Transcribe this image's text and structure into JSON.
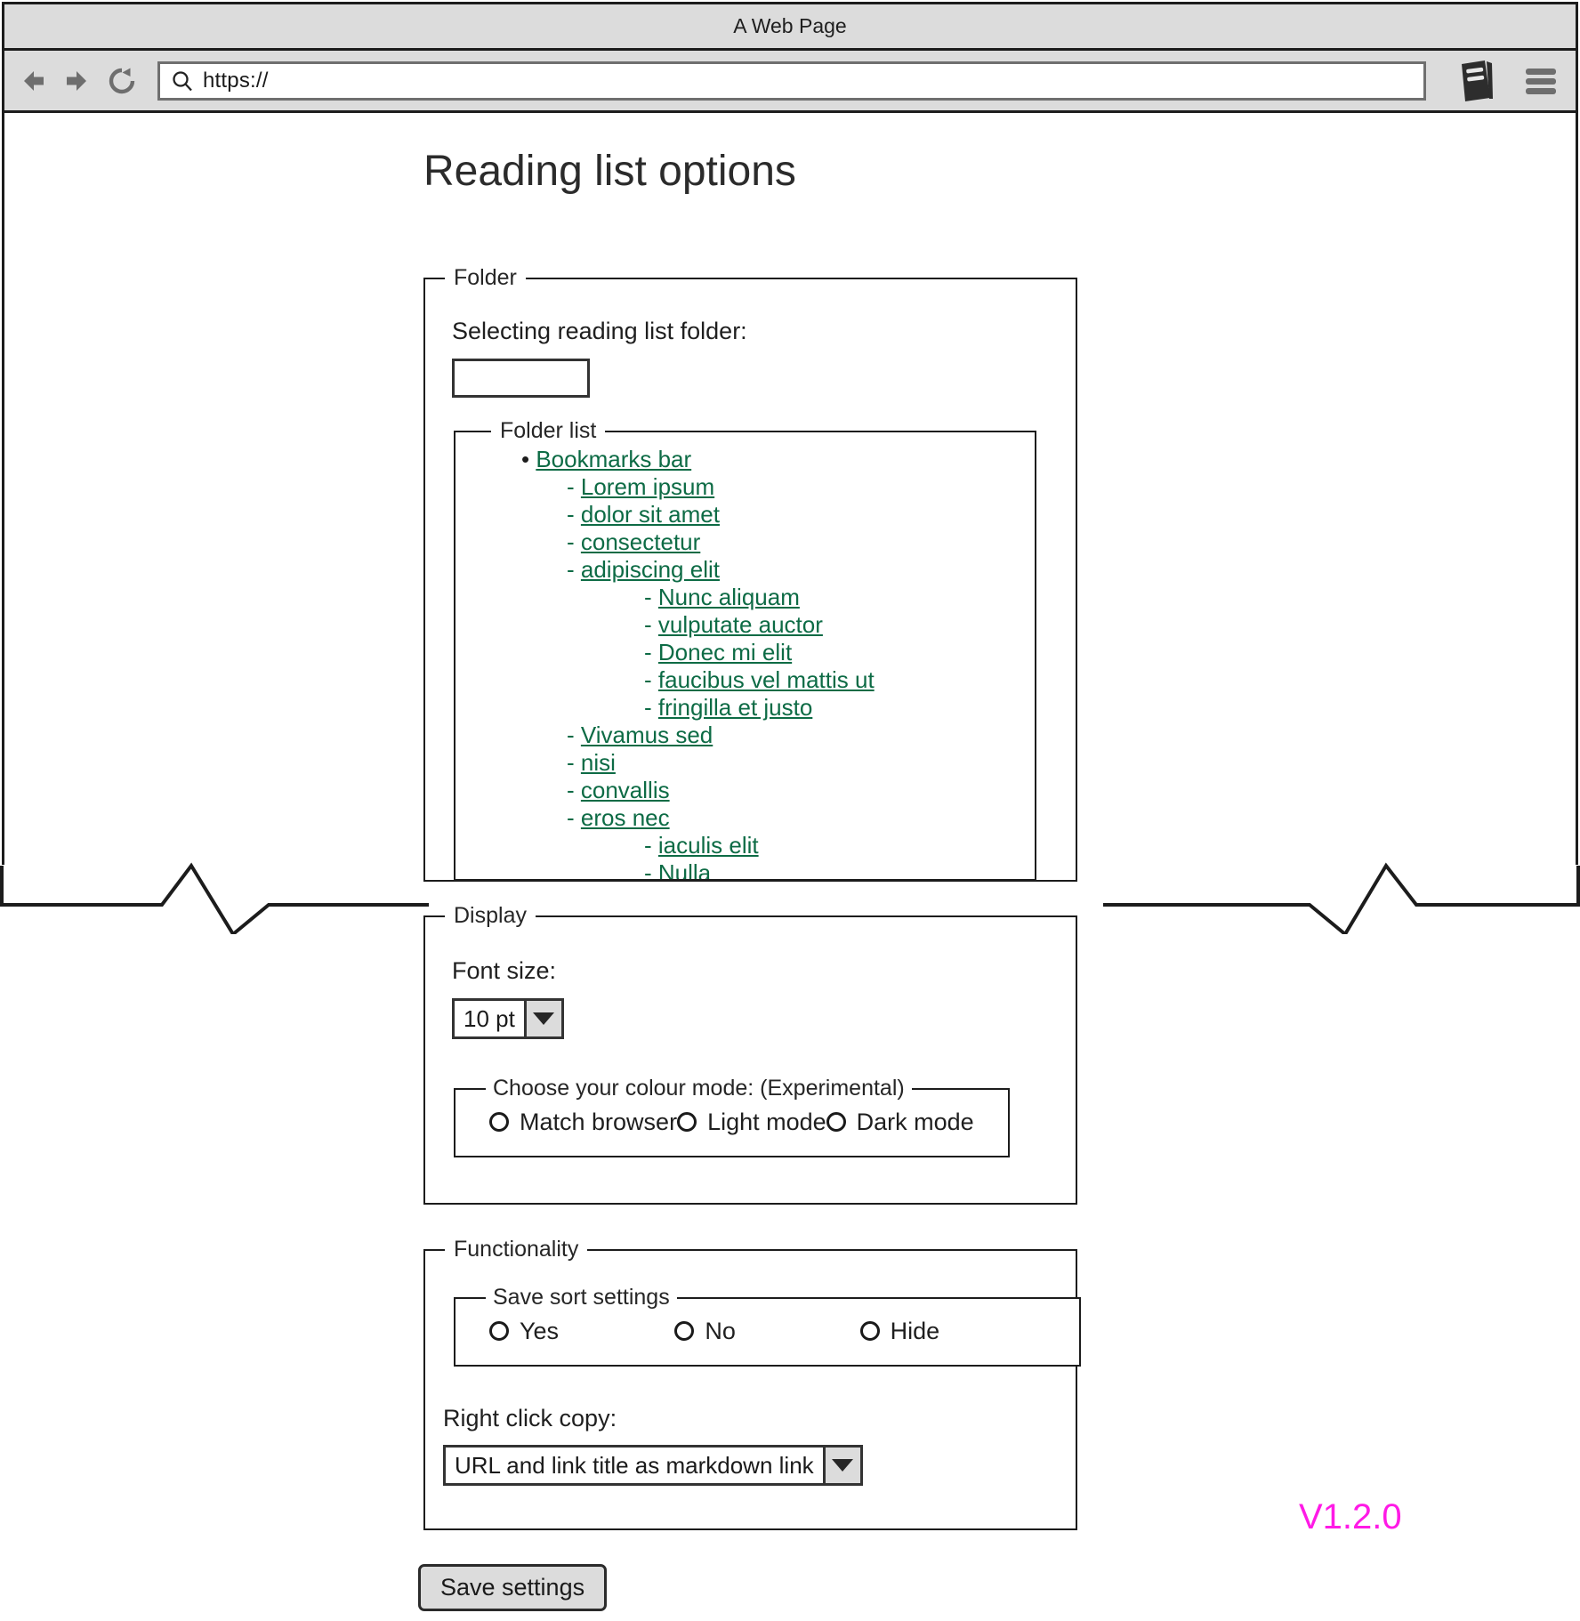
{
  "browser": {
    "window_title": "A Web Page",
    "url_value": "https://",
    "icons": {
      "back": "back-arrow-icon",
      "forward": "forward-arrow-icon",
      "reload": "reload-icon",
      "search": "search-icon",
      "book": "book-icon",
      "menu": "hamburger-menu-icon"
    }
  },
  "page": {
    "title": "Reading list options",
    "version": "V1.2.0",
    "save_button": "Save settings",
    "accent_version_color": "#ff1ae6",
    "link_color": "#0d6b45"
  },
  "folder_section": {
    "legend": "Folder",
    "label": "Selecting reading list folder:",
    "input_value": "",
    "input_placeholder": "",
    "folder_list": {
      "legend": "Folder list",
      "items": [
        {
          "level": 0,
          "marker": "•",
          "label": "Bookmarks bar"
        },
        {
          "level": 1,
          "marker": "-",
          "label": "Lorem ipsum "
        },
        {
          "level": 1,
          "marker": "-",
          "label": "dolor sit amet"
        },
        {
          "level": 1,
          "marker": "-",
          "label": "consectetur"
        },
        {
          "level": 1,
          "marker": "-",
          "label": "adipiscing elit"
        },
        {
          "level": 2,
          "marker": "-",
          "label": "Nunc aliquam "
        },
        {
          "level": 2,
          "marker": "-",
          "label": "vulputate auctor"
        },
        {
          "level": 2,
          "marker": "-",
          "label": "Donec mi elit"
        },
        {
          "level": 2,
          "marker": "-",
          "label": "faucibus vel mattis ut"
        },
        {
          "level": 2,
          "marker": "-",
          "label": "fringilla et justo"
        },
        {
          "level": 1,
          "marker": "-",
          "label": "Vivamus sed"
        },
        {
          "level": 1,
          "marker": "-",
          "label": "nisi"
        },
        {
          "level": 1,
          "marker": "-",
          "label": "convallis"
        },
        {
          "level": 1,
          "marker": "-",
          "label": "eros nec"
        },
        {
          "level": 2,
          "marker": "-",
          "label": "iaculis elit"
        },
        {
          "level": 2,
          "marker": "-",
          "label": "Nulla"
        }
      ]
    }
  },
  "display_section": {
    "legend": "Display",
    "font_size_label": "Font size:",
    "font_size_value": "10 pt",
    "colour_mode": {
      "legend": "Choose your colour mode: (Experimental)",
      "options": [
        {
          "label": "Match browser",
          "selected": false
        },
        {
          "label": "Light mode",
          "selected": false
        },
        {
          "label": "Dark mode",
          "selected": false
        }
      ]
    }
  },
  "functionality_section": {
    "legend": "Functionality",
    "save_sort": {
      "legend": "Save sort settings",
      "options": [
        {
          "label": "Yes",
          "selected": false
        },
        {
          "label": "No",
          "selected": false
        },
        {
          "label": "Hide",
          "selected": false
        }
      ]
    },
    "right_click_copy_label": "Right click copy:",
    "right_click_copy_value": "URL and link title as markdown link"
  }
}
